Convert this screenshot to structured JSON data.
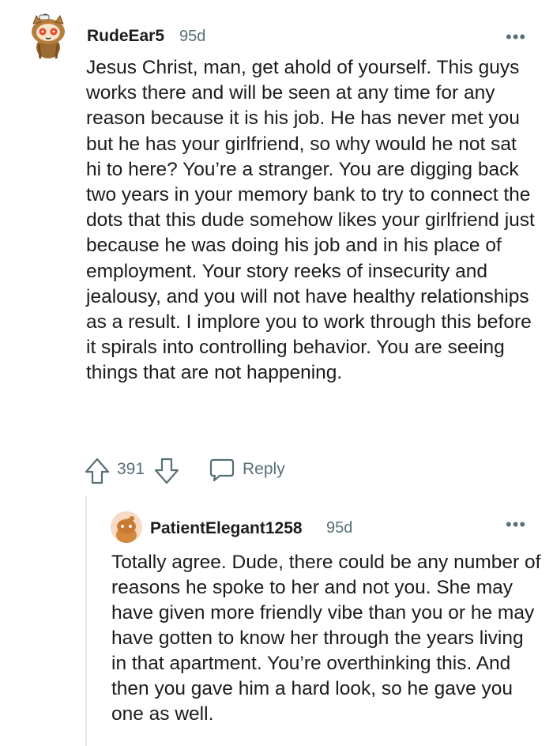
{
  "comment": {
    "author": "RudeEar5",
    "time": "95d",
    "body": "Jesus Christ, man, get ahold of yourself. This guys works there and will be seen at any time for any reason because it is his job. He has never met you but he has your girlfriend, so why would he not sat hi to here? You’re a stranger. You are digging back two years in your memory bank to try to connect the dots that this dude somehow likes your girlfriend just because he was doing his job and in his place of employment. Your story reeks of insecurity and jealousy, and you will not have healthy relationships as a result. I implore you to work through this before it spirals into controlling behavior. You are seeing things that are not happening.",
    "score": "391",
    "reply_label": "Reply",
    "more_label": "•••",
    "avatar_icon": "snoo-avatar-icon"
  },
  "reply": {
    "author": "PatientElegant1258",
    "time": "95d",
    "body": "Totally agree. Dude, there could be any number of reasons he spoke to her and not you. She may have given more friendly vibe than you or he may have gotten to know her through the years living in that apartment. You’re overthinking this. And then you gave him a hard look, so he gave you one as well.",
    "more_label": "•••",
    "avatar_icon": "snoo-avatar-icon"
  },
  "colors": {
    "text": "#1c1c1c",
    "meta": "#576f76",
    "thread_line": "#e5ebee"
  }
}
